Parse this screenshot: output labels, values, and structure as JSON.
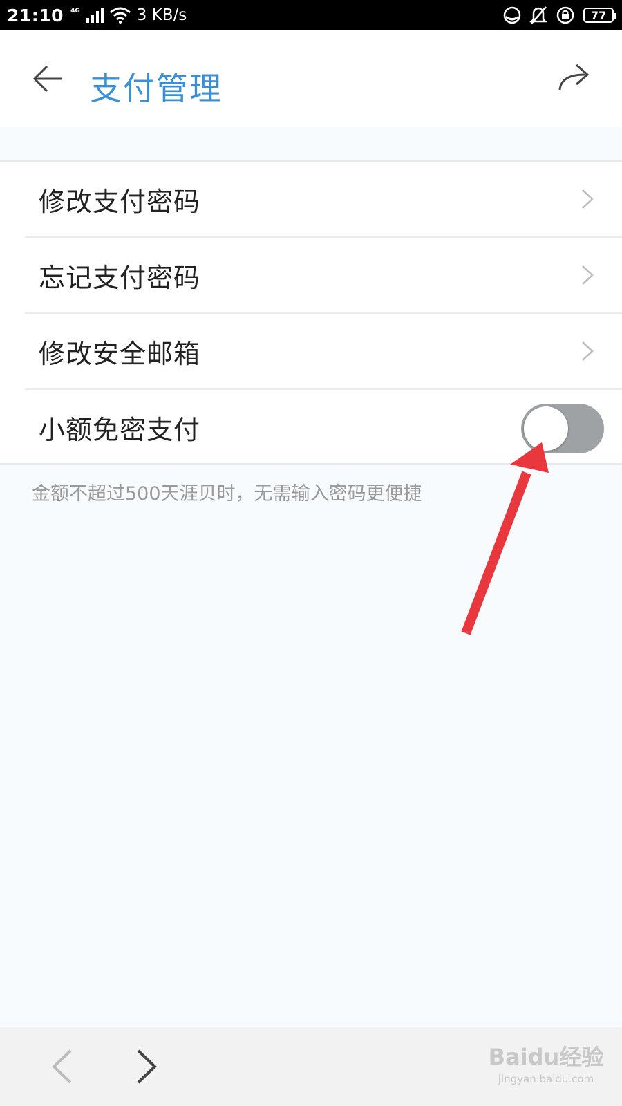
{
  "status_bar": {
    "time": "21:10",
    "network": "4G",
    "speed": "3 KB/s",
    "battery": "77"
  },
  "header": {
    "title": "支付管理",
    "title_color": "#3a8fd6",
    "back_icon": "arrow-left-icon",
    "share_icon": "share-icon"
  },
  "settings": {
    "items": [
      {
        "label": "修改支付密码"
      },
      {
        "label": "忘记支付密码"
      },
      {
        "label": "修改安全邮箱"
      }
    ],
    "toggle_item": {
      "label": "小额免密支付",
      "enabled": false
    },
    "hint": "金额不超过500天涯贝时，无需输入密码更便捷"
  },
  "annotation": {
    "color": "#e8373d"
  },
  "bottom_bar": {
    "watermark": "Baidu经验",
    "watermark_sub": "jingyan.baidu.com"
  }
}
